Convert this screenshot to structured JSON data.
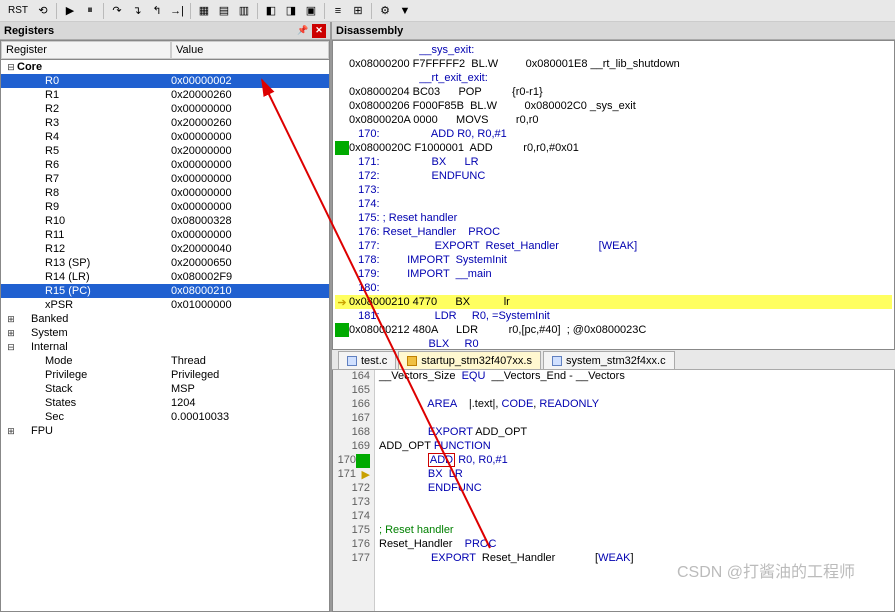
{
  "toolbar": {
    "rst_label": "RST"
  },
  "panels": {
    "registers_title": "Registers",
    "disassembly_title": "Disassembly",
    "reg_header_name": "Register",
    "reg_header_val": "Value"
  },
  "reg_tree": {
    "core": "Core",
    "rows": [
      {
        "name": "R0",
        "val": "0x00000002",
        "sel": true
      },
      {
        "name": "R1",
        "val": "0x20000260"
      },
      {
        "name": "R2",
        "val": "0x00000000"
      },
      {
        "name": "R3",
        "val": "0x20000260"
      },
      {
        "name": "R4",
        "val": "0x00000000"
      },
      {
        "name": "R5",
        "val": "0x20000000"
      },
      {
        "name": "R6",
        "val": "0x00000000"
      },
      {
        "name": "R7",
        "val": "0x00000000"
      },
      {
        "name": "R8",
        "val": "0x00000000"
      },
      {
        "name": "R9",
        "val": "0x00000000"
      },
      {
        "name": "R10",
        "val": "0x08000328"
      },
      {
        "name": "R11",
        "val": "0x00000000"
      },
      {
        "name": "R12",
        "val": "0x20000040"
      },
      {
        "name": "R13 (SP)",
        "val": "0x20000650"
      },
      {
        "name": "R14 (LR)",
        "val": "0x080002F9"
      },
      {
        "name": "R15 (PC)",
        "val": "0x08000210",
        "sel": true
      },
      {
        "name": "xPSR",
        "val": "0x01000000"
      }
    ],
    "banked": "Banked",
    "system": "System",
    "internal": "Internal",
    "internal_rows": [
      {
        "name": "Mode",
        "val": "Thread"
      },
      {
        "name": "Privilege",
        "val": "Privileged"
      },
      {
        "name": "Stack",
        "val": "MSP"
      },
      {
        "name": "States",
        "val": "1204"
      },
      {
        "name": "Sec",
        "val": "0.00010033"
      }
    ],
    "fpu": "FPU"
  },
  "disasm": {
    "lines": [
      {
        "m": "",
        "t": "                       __sys_exit:",
        "cls": "label-blue"
      },
      {
        "m": "",
        "t": "0x08000200 F7FFFFF2  BL.W         0x080001E8 __rt_lib_shutdown"
      },
      {
        "m": "",
        "t": "                       __rt_exit_exit:",
        "cls": "label-blue"
      },
      {
        "m": "",
        "t": "0x08000204 BC03      POP          {r0-r1}"
      },
      {
        "m": "",
        "t": "0x08000206 F000F85B  BL.W         0x080002C0 _sys_exit"
      },
      {
        "m": "",
        "t": "0x0800020A 0000      MOVS         r0,r0"
      },
      {
        "m": "",
        "t": "   170:                 ADD R0, R0,#1 ",
        "cls": "comment-blue"
      },
      {
        "m": "g",
        "t": "0x0800020C F1000001  ADD          r0,r0,#0x01"
      },
      {
        "m": "",
        "t": "   171:                 BX      LR ",
        "cls": "comment-blue"
      },
      {
        "m": "",
        "t": "   172:                 ENDFUNC ",
        "cls": "comment-blue"
      },
      {
        "m": "",
        "t": "   173:  ",
        "cls": "comment-blue"
      },
      {
        "m": "",
        "t": "   174:  ",
        "cls": "comment-blue"
      },
      {
        "m": "",
        "t": "   175: ; Reset handler ",
        "cls": "comment-blue"
      },
      {
        "m": "",
        "t": "   176: Reset_Handler    PROC ",
        "cls": "comment-blue"
      },
      {
        "m": "",
        "t": "   177:                  EXPORT  Reset_Handler             [WEAK] ",
        "cls": "comment-blue"
      },
      {
        "m": "",
        "t": "   178:         IMPORT  SystemInit ",
        "cls": "comment-blue"
      },
      {
        "m": "",
        "t": "   179:         IMPORT  __main ",
        "cls": "comment-blue"
      },
      {
        "m": "",
        "t": "   180:  ",
        "cls": "comment-blue"
      },
      {
        "m": "y",
        "t": "0x08000210 4770      BX           lr",
        "hl": true
      },
      {
        "m": "",
        "t": "   181:                  LDR     R0, =SystemInit ",
        "cls": "comment-blue"
      },
      {
        "m": "g",
        "t": "0x08000212 480A      LDR          r0,[pc,#40]  ; @0x0800023C"
      },
      {
        "m": "",
        "t": "                          BLX     R0",
        "cls": "comment-blue"
      }
    ]
  },
  "tabs": {
    "t0": "test.c",
    "t1": "startup_stm32f407xx.s",
    "t2": "system_stm32f4xx.c"
  },
  "source": {
    "rows": [
      {
        "ln": "164",
        "t": "__Vectors_Size  EQU  __Vectors_End - __Vectors"
      },
      {
        "ln": "165",
        "t": ""
      },
      {
        "ln": "166",
        "t": "                AREA    |.text|, CODE, READONLY"
      },
      {
        "ln": "167",
        "t": ""
      },
      {
        "ln": "168",
        "t": "                EXPORT ADD_OPT"
      },
      {
        "ln": "169",
        "t": "ADD_OPT FUNCTION"
      },
      {
        "ln": "170",
        "t": "                ADD R0, R0,#1",
        "box": true,
        "mk": "g"
      },
      {
        "ln": "171",
        "t": "                BX  LR",
        "mk": "y"
      },
      {
        "ln": "172",
        "t": "                ENDFUNC"
      },
      {
        "ln": "173",
        "t": ""
      },
      {
        "ln": "174",
        "t": ""
      },
      {
        "ln": "175",
        "t": "; Reset handler"
      },
      {
        "ln": "176",
        "t": "Reset_Handler    PROC"
      },
      {
        "ln": "177",
        "t": "                 EXPORT  Reset_Handler             [WEAK]"
      }
    ]
  },
  "watermark": "CSDN @打酱油的工程师"
}
